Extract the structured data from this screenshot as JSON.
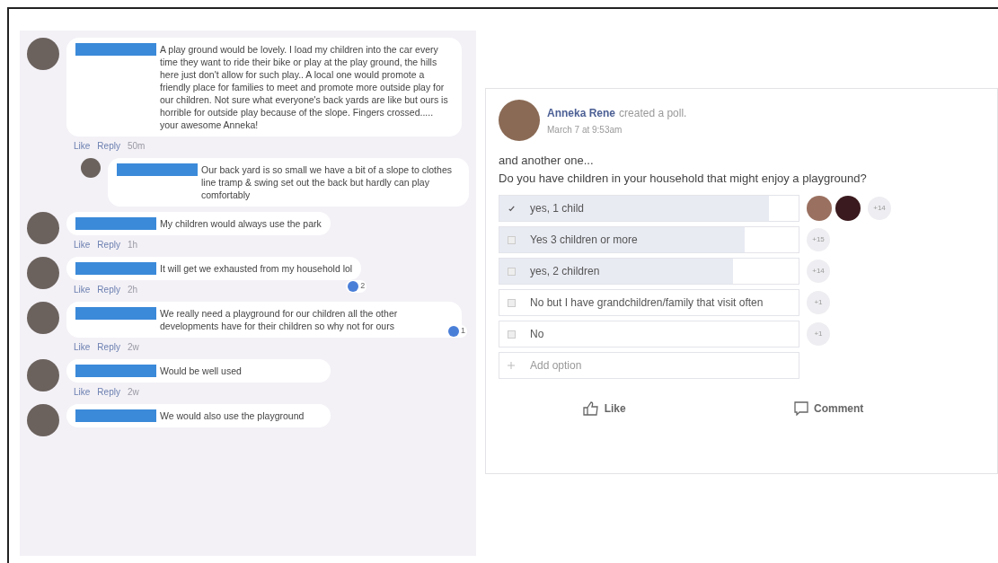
{
  "comments": [
    {
      "text": "A play ground would be lovely. I load my children into the car every time they want to ride their bike or play at the play ground, the hills here just don't allow for such play.. A local one would promote a friendly place for families to meet and promote more outside play for our children. Not sure what everyone's back yards are like but ours is horrible for outside play because of the slope. Fingers crossed..... your awesome Anneka!",
      "actions": [
        "Like",
        "Reply",
        "50m"
      ],
      "replies": [
        {
          "text": "Our back yard is so small we have a bit of a slope to clothes line tramp & swing set out the back but hardly can play comfortably"
        }
      ]
    },
    {
      "text": "My children would always use the park",
      "actions": [
        "Like",
        "Reply",
        "1h"
      ]
    },
    {
      "text": "It will get we exhausted from my household lol",
      "actions": [
        "Like",
        "Reply",
        "2h"
      ],
      "reactions": "2"
    },
    {
      "text": "We really need a playground for our children all the other developments have for their children so why not for ours",
      "actions": [
        "Like",
        "Reply",
        "2w"
      ],
      "reactions": "1"
    },
    {
      "text": "Would be well used",
      "actions": [
        "Like",
        "Reply",
        "2w"
      ]
    },
    {
      "text": "We would also use the playground"
    }
  ],
  "post": {
    "author": "Anneka Rene",
    "action": "created a poll.",
    "time": "March 7 at 9:53am",
    "text": [
      "and another one...",
      "Do you have children in your household that might enjoy a playground?"
    ],
    "options": [
      {
        "label": "yes, 1 child",
        "selected": true,
        "level": 0.9,
        "count": "+14",
        "voter_avatars": true
      },
      {
        "label": "Yes 3 children or more",
        "selected": false,
        "level": 0.82,
        "count": "+15"
      },
      {
        "label": "yes, 2 children",
        "selected": false,
        "level": 0.78,
        "count": "+14"
      },
      {
        "label": "No but I have grandchildren/family that visit often",
        "selected": false,
        "level": 0,
        "count": "+1"
      },
      {
        "label": "No",
        "selected": false,
        "level": 0,
        "count": "+1"
      }
    ],
    "add_option": "Add option",
    "buttons": [
      {
        "kind": "like",
        "label": "Like"
      },
      {
        "kind": "comment",
        "label": "Comment"
      }
    ]
  }
}
